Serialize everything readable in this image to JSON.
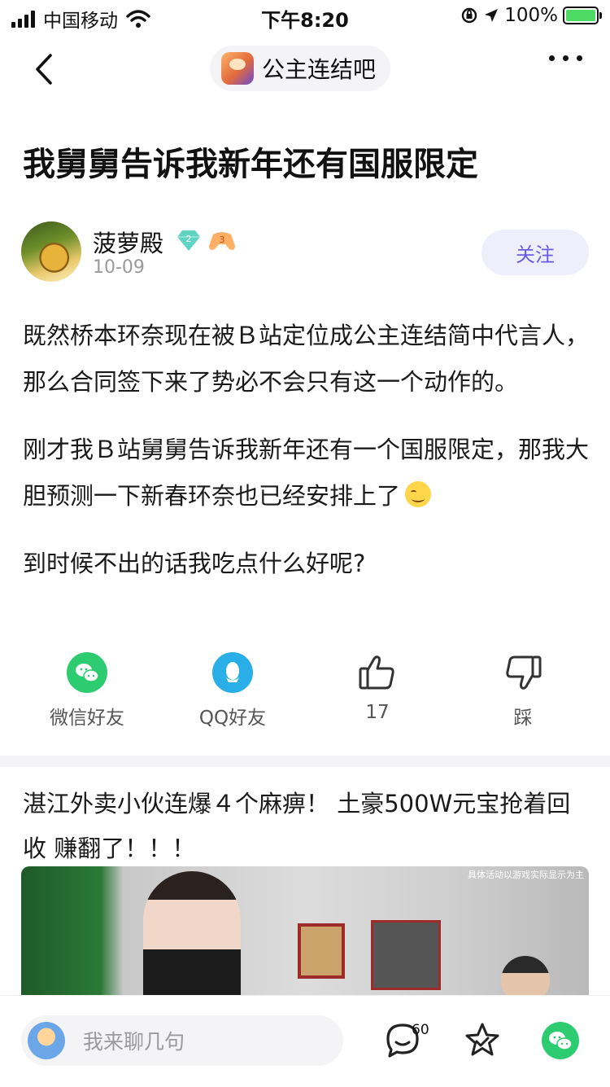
{
  "status_bar": {
    "carrier": "中国移动",
    "time": "下午8:20",
    "battery": "100%"
  },
  "nav": {
    "forum_name": "公主连结吧"
  },
  "post": {
    "title": "我舅舅告诉我新年还有国服限定",
    "author": {
      "name": "菠萝殿",
      "date": "10-09",
      "level_badge": "2",
      "game_badge": "3"
    },
    "follow_label": "关注",
    "paragraphs": [
      "既然桥本环奈现在被Ｂ站定位成公主连结简中代言人，那么合同签下来了势必不会只有这一个动作的。",
      "刚才我Ｂ站舅舅告诉我新年还有一个国服限定，那我大胆预测一下新春环奈也已经安排上了",
      "到时候不出的话我吃点什么好呢?"
    ]
  },
  "actions": {
    "wechat_label": "微信好友",
    "qq_label": "QQ好友",
    "like_count": "17",
    "dislike_label": "踩"
  },
  "ad": {
    "title": "湛江外卖小伙连爆４个麻痹！ 土豪500W元宝抢着回收 赚翻了！！！",
    "caption": "具体活动以游戏实际显示为主"
  },
  "bottom_bar": {
    "comment_placeholder": "我来聊几句",
    "comment_count": "60"
  },
  "colors": {
    "accent": "#6b5ce7",
    "wechat": "#2ecc71",
    "qq": "#29aee8"
  }
}
